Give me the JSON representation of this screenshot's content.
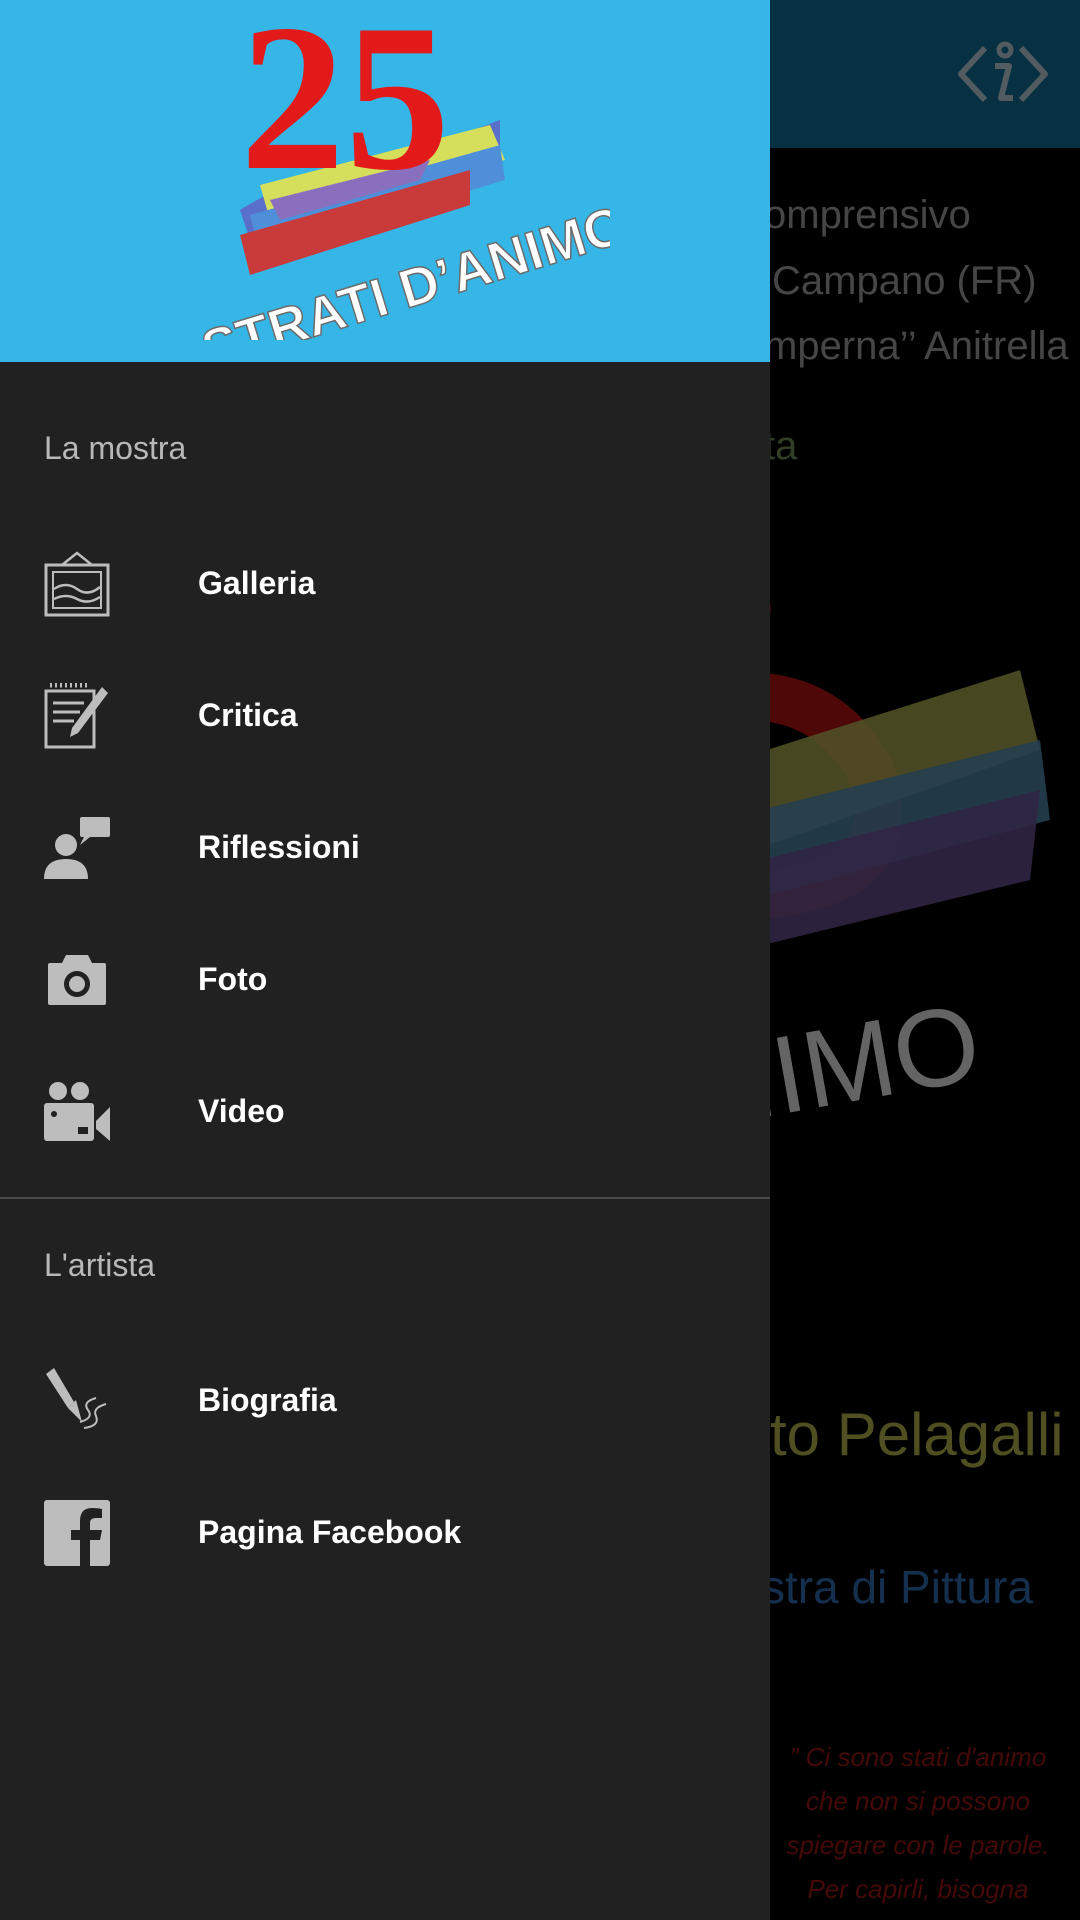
{
  "background": {
    "info_icon": "info-code-icon",
    "school_lines": [
      "omprensivo",
      "Campano (FR)",
      "mperna’’ Anitrella"
    ],
    "short_line": "ta",
    "logo_big_text": "ANIMO",
    "artist_name": "to Pelagalli",
    "exhibition": "stra di Pittura",
    "quote_lines": [
      "” Ci sono stati d'animo",
      "che non si possono",
      "spiegare con le parole.",
      "Per capirli,  bisogna"
    ]
  },
  "drawer": {
    "header": {
      "logo_number": "25",
      "logo_text": "STRATI D’ANIMO",
      "bg_color": "#35b6e7"
    },
    "sections": [
      {
        "title": "La mostra",
        "items": [
          {
            "label": "Galleria",
            "icon": "gallery-frame-icon"
          },
          {
            "label": "Critica",
            "icon": "notepad-pencil-icon"
          },
          {
            "label": "Riflessioni",
            "icon": "person-speech-icon"
          },
          {
            "label": "Foto",
            "icon": "camera-icon"
          },
          {
            "label": "Video",
            "icon": "video-camera-icon"
          }
        ]
      },
      {
        "title": "L'artista",
        "items": [
          {
            "label": "Biografia",
            "icon": "fountain-pen-icon"
          },
          {
            "label": "Pagina Facebook",
            "icon": "facebook-icon"
          }
        ]
      }
    ]
  }
}
